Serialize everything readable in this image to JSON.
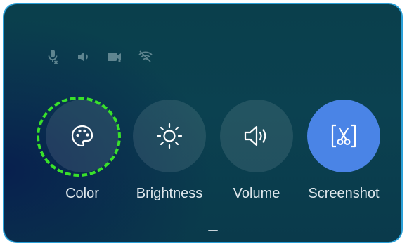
{
  "status_icons": [
    {
      "name": "microphone-muted-icon"
    },
    {
      "name": "speaker-icon"
    },
    {
      "name": "camera-muted-icon"
    },
    {
      "name": "wifi-off-icon"
    }
  ],
  "tiles": [
    {
      "label": "Color",
      "icon": "palette-icon",
      "focused": true,
      "active": false
    },
    {
      "label": "Brightness",
      "icon": "sun-icon",
      "focused": false,
      "active": false
    },
    {
      "label": "Volume",
      "icon": "volume-icon",
      "focused": false,
      "active": false
    },
    {
      "label": "Screenshot",
      "icon": "screenshot-scissors-icon",
      "focused": false,
      "active": true
    }
  ],
  "colors": {
    "panel_background": "#0b4150",
    "panel_border": "#2aa0d8",
    "tile_background": "rgba(255,255,255,0.10)",
    "active_tile": "#4a84e6",
    "focus_ring": "#39e12a",
    "label_text": "#dfe7ec",
    "status_icon": "#5f8590"
  }
}
